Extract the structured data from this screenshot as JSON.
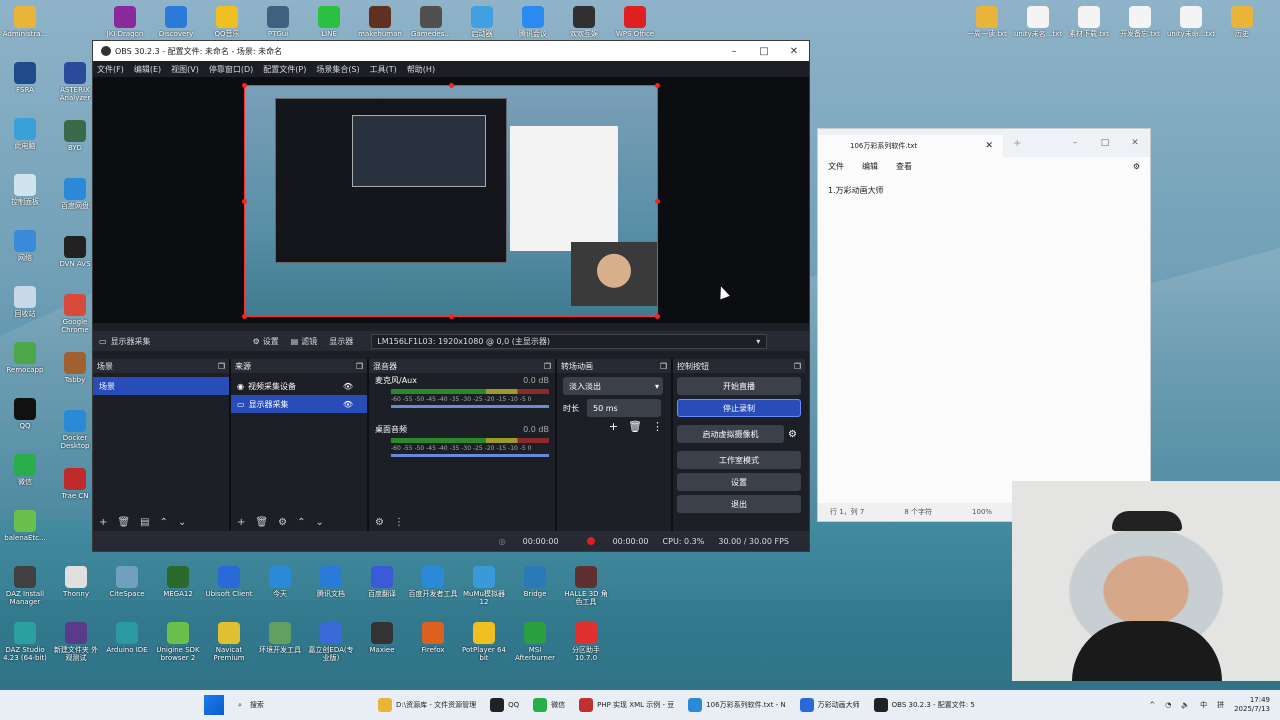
{
  "desktop_left": [
    {
      "label": "Administra...",
      "color": "#e8b43a",
      "glyph": "folder-icon"
    },
    {
      "label": "FSRA",
      "color": "#1f4b8a",
      "glyph": "app-icon"
    },
    {
      "label": "此电脑",
      "color": "#3aa0d8",
      "glyph": "monitor-icon"
    },
    {
      "label": "控制面板",
      "color": "#d0e4f0",
      "glyph": "settings-icon"
    },
    {
      "label": "网络",
      "color": "#3a8ad8",
      "glyph": "network-icon"
    },
    {
      "label": "回收站",
      "color": "#c8d8e8",
      "glyph": "trash-icon"
    },
    {
      "label": "Remocapp ",
      "color": "#4aa84a",
      "glyph": "app-icon"
    },
    {
      "label": "QQ",
      "color": "#111",
      "glyph": "qq-icon"
    },
    {
      "label": "微信",
      "color": "#2aae4a",
      "glyph": "wechat-icon"
    },
    {
      "label": "balenaEtc...",
      "color": "#6ac04a",
      "glyph": "cube-icon"
    }
  ],
  "desktop_col2": [
    {
      "label": "ASTERIX Analyzer",
      "color": "#2a4a9a"
    },
    {
      "label": "BYD",
      "color": "#3a6a4a"
    },
    {
      "label": "百度网盘",
      "color": "#2a8ad8"
    },
    {
      "label": "DVN AVS",
      "color": "#222"
    },
    {
      "label": "Google Chrome",
      "color": "#d84a3a"
    },
    {
      "label": "Tabby",
      "color": "#a06030"
    },
    {
      "label": "Docker Desktop",
      "color": "#2a8ad8"
    },
    {
      "label": "Trae CN",
      "color": "#c02a2a"
    }
  ],
  "desktop_top": [
    {
      "label": "JKI Dragon",
      "color": "#8a2a9a"
    },
    {
      "label": "Discovery",
      "color": "#2a7ad8"
    },
    {
      "label": "QQ音乐",
      "color": "#f0c020"
    },
    {
      "label": "PTGui",
      "color": "#406080"
    },
    {
      "label": "LINE",
      "color": "#2ac040"
    },
    {
      "label": "makehuman",
      "color": "#603020"
    },
    {
      "label": "Gamedes...",
      "color": "#505050"
    },
    {
      "label": "启动器",
      "color": "#40a0e0"
    },
    {
      "label": "腾讯会议",
      "color": "#2a8af0"
    },
    {
      "label": "欢欢互娱",
      "color": "#303030"
    },
    {
      "label": "WPS Office",
      "color": "#e02020"
    }
  ],
  "desktop_bottom_row1": [
    {
      "label": "DAZ Install Manager",
      "color": "#404040"
    },
    {
      "label": "Thonny",
      "color": "#e0e0e0"
    },
    {
      "label": "CiteSpace",
      "color": "#70a0c0"
    },
    {
      "label": "MEGA12",
      "color": "#2a6a2a"
    },
    {
      "label": "Ubisoft Client",
      "color": "#2a6ad8"
    },
    {
      "label": "今天",
      "color": "#2a8ad8"
    },
    {
      "label": "腾讯文档",
      "color": "#2a7ad8"
    },
    {
      "label": "百度翻译",
      "color": "#3a5ad8"
    },
    {
      "label": "百度开发者工具",
      "color": "#2a8ad8"
    },
    {
      "label": "MuMu模拟器12",
      "color": "#3a9ad8"
    },
    {
      "label": "Bridge",
      "color": "#2a7ab8"
    },
    {
      "label": "HALLE 3D 角色工具",
      "color": "#603030"
    }
  ],
  "desktop_bottom_row2": [
    {
      "label": "DAZ Studio 4.23 (64-bit)",
      "color": "#2aa0a0"
    },
    {
      "label": "新建文件夹 外观测试",
      "color": "#5a3a8a"
    },
    {
      "label": "Arduino IDE",
      "color": "#2a9aa0"
    },
    {
      "label": "Unigine SDK browser 2",
      "color": "#6ac04a"
    },
    {
      "label": "Navicat Premium",
      "color": "#e0c030"
    },
    {
      "label": "环境开发工具",
      "color": "#60a060"
    },
    {
      "label": "嘉立创EDA(专业版)",
      "color": "#3a6ad8"
    },
    {
      "label": "Maxiee",
      "color": "#333"
    },
    {
      "label": "Firefox",
      "color": "#e06020"
    },
    {
      "label": "PotPlayer 64 bit",
      "color": "#f0c020"
    },
    {
      "label": "MSI Afterburner",
      "color": "#2aa040"
    },
    {
      "label": "分区助手 10.7.0",
      "color": "#e03030"
    }
  ],
  "desktop_right": [
    {
      "label": "一周一读.txt",
      "color": "#e8b43a"
    },
    {
      "label": "unity未名...txt",
      "color": "#f4f4f4"
    },
    {
      "label": "素材下载.txt",
      "color": "#f4f4f4"
    },
    {
      "label": "开发备忘.txt",
      "color": "#f4f4f4"
    },
    {
      "label": "unity未命...txt",
      "color": "#f4f4f4"
    },
    {
      "label": "历史",
      "color": "#e8b43a"
    }
  ],
  "obs": {
    "title": "OBS 30.2.3 - 配置文件: 未命名 - 场景: 未命名",
    "menu": [
      "文件(F)",
      "编辑(E)",
      "视图(V)",
      "停靠窗口(D)",
      "配置文件(P)",
      "场景集合(S)",
      "工具(T)",
      "帮助(H)"
    ],
    "source_name": "显示器采集",
    "props_btn": "设置",
    "filters_btn": "滤镜",
    "display_label": "显示器",
    "display_value": "LM156LF1L03: 1920x1080 @ 0,0 (主显示器)",
    "scenes_title": "场景",
    "scene_item": "场景",
    "sources_title": "来源",
    "sources": [
      "视频采集设备",
      "显示器采集"
    ],
    "mixer_title": "混音器",
    "mic_label": "麦克风/Aux",
    "mic_db": "0.0 dB",
    "desktop_audio": "桌面音频",
    "desktop_db": "0.0 dB",
    "meter_ticks": "-60 -55 -50 -45 -40 -35 -30 -25 -20 -15 -10 -5 0",
    "transition_title": "转场动画",
    "transition": "淡入淡出",
    "duration_label": "时长",
    "duration": "50 ms",
    "controls_title": "控制按钮",
    "controls": [
      "开始直播",
      "停止录制",
      "启动虚拟摄像机",
      "工作室模式",
      "设置",
      "退出"
    ],
    "status_stream_time": "00:00:00",
    "status_rec_time": "00:00:00",
    "status_cpu": "CPU: 0.3%",
    "status_fps": "30.00 / 30.00 FPS"
  },
  "notepad": {
    "tab_title": "106万彩系列软件.txt",
    "menu": [
      "文件",
      "编辑",
      "查看"
    ],
    "content": "1.万彩动画大师",
    "status_pos": "行 1，列 7",
    "status_chars": "8 个字符",
    "status_zoom": "100%"
  },
  "taskbar": {
    "search": "搜索",
    "apps": [
      {
        "label": "D:\\资源库 - 文件资源管理",
        "color": "#e8b43a"
      },
      {
        "label": "QQ",
        "color": "#222"
      },
      {
        "label": "微信",
        "color": "#2aae4a"
      },
      {
        "label": "PHP 实现 XML 示例 - 豆",
        "color": "#c03030"
      },
      {
        "label": "106万彩系列软件.txt - N",
        "color": "#2a8ad8"
      },
      {
        "label": "万彩动画大师",
        "color": "#2a6ad8"
      },
      {
        "label": "OBS 30.2.3 - 配置文件: 5",
        "color": "#222"
      }
    ],
    "tray": [
      "^",
      "中",
      "拼"
    ],
    "time": "17:49",
    "date": "2025/7/13"
  }
}
